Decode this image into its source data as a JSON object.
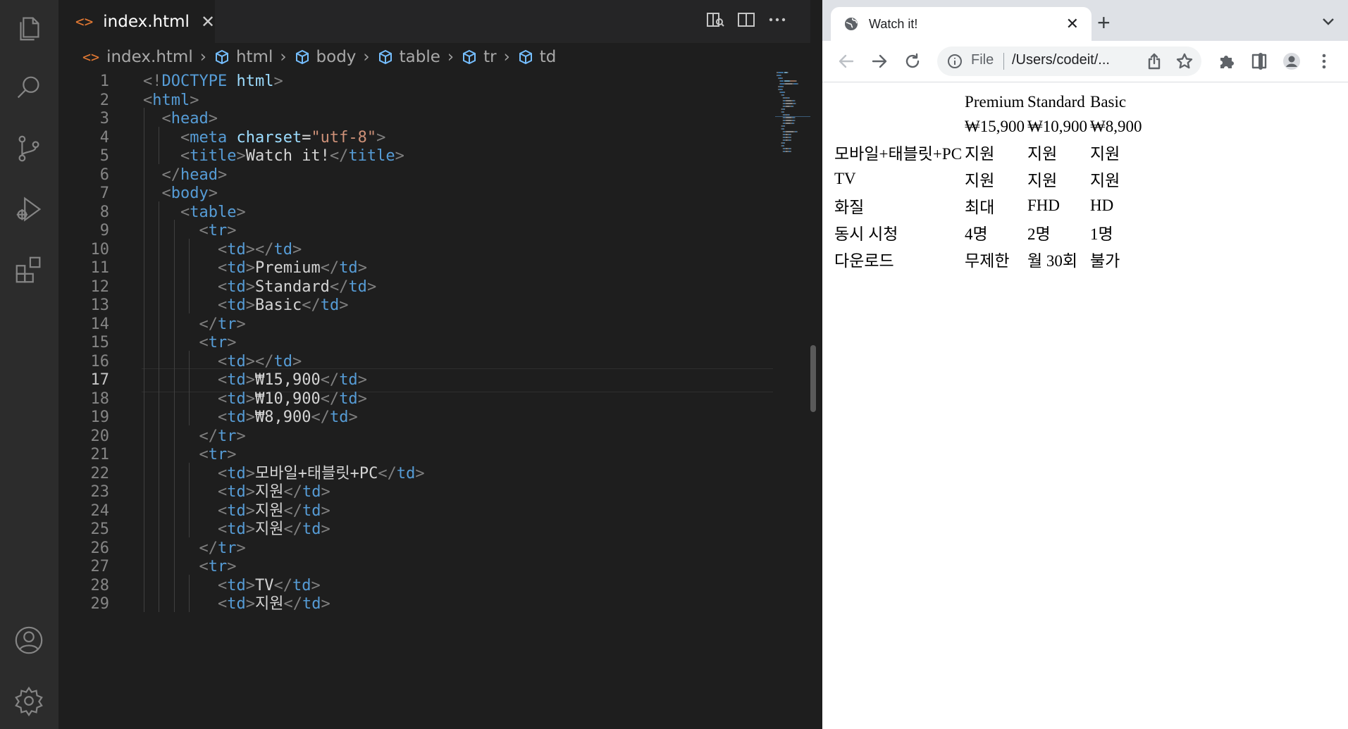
{
  "editor": {
    "tab_title": "index.html",
    "tab_icon": "<>",
    "breadcrumb": [
      "index.html",
      "html",
      "body",
      "table",
      "tr",
      "td"
    ],
    "current_line": 17,
    "lines": [
      [
        [
          "p",
          "<!"
        ],
        [
          "tag",
          "DOCTYPE"
        ],
        [
          "txt",
          " "
        ],
        [
          "attr",
          "html"
        ],
        [
          "p",
          ">"
        ]
      ],
      [
        [
          "p",
          "<"
        ],
        [
          "tag",
          "html"
        ],
        [
          "p",
          ">"
        ]
      ],
      [
        [
          "txt",
          "  "
        ],
        [
          "p",
          "<"
        ],
        [
          "tag",
          "head"
        ],
        [
          "p",
          ">"
        ]
      ],
      [
        [
          "txt",
          "    "
        ],
        [
          "p",
          "<"
        ],
        [
          "tag",
          "meta"
        ],
        [
          "txt",
          " "
        ],
        [
          "attr",
          "charset"
        ],
        [
          "txt",
          "="
        ],
        [
          "str",
          "\"utf-8\""
        ],
        [
          "p",
          ">"
        ]
      ],
      [
        [
          "txt",
          "    "
        ],
        [
          "p",
          "<"
        ],
        [
          "tag",
          "title"
        ],
        [
          "p",
          ">"
        ],
        [
          "txt",
          "Watch it!"
        ],
        [
          "p",
          "</"
        ],
        [
          "tag",
          "title"
        ],
        [
          "p",
          ">"
        ]
      ],
      [
        [
          "txt",
          "  "
        ],
        [
          "p",
          "</"
        ],
        [
          "tag",
          "head"
        ],
        [
          "p",
          ">"
        ]
      ],
      [
        [
          "txt",
          "  "
        ],
        [
          "p",
          "<"
        ],
        [
          "tag",
          "body"
        ],
        [
          "p",
          ">"
        ]
      ],
      [
        [
          "txt",
          "    "
        ],
        [
          "p",
          "<"
        ],
        [
          "tag",
          "table"
        ],
        [
          "p",
          ">"
        ]
      ],
      [
        [
          "txt",
          "      "
        ],
        [
          "p",
          "<"
        ],
        [
          "tag",
          "tr"
        ],
        [
          "p",
          ">"
        ]
      ],
      [
        [
          "txt",
          "        "
        ],
        [
          "p",
          "<"
        ],
        [
          "tag",
          "td"
        ],
        [
          "p",
          "></"
        ],
        [
          "tag",
          "td"
        ],
        [
          "p",
          ">"
        ]
      ],
      [
        [
          "txt",
          "        "
        ],
        [
          "p",
          "<"
        ],
        [
          "tag",
          "td"
        ],
        [
          "p",
          ">"
        ],
        [
          "txt",
          "Premium"
        ],
        [
          "p",
          "</"
        ],
        [
          "tag",
          "td"
        ],
        [
          "p",
          ">"
        ]
      ],
      [
        [
          "txt",
          "        "
        ],
        [
          "p",
          "<"
        ],
        [
          "tag",
          "td"
        ],
        [
          "p",
          ">"
        ],
        [
          "txt",
          "Standard"
        ],
        [
          "p",
          "</"
        ],
        [
          "tag",
          "td"
        ],
        [
          "p",
          ">"
        ]
      ],
      [
        [
          "txt",
          "        "
        ],
        [
          "p",
          "<"
        ],
        [
          "tag",
          "td"
        ],
        [
          "p",
          ">"
        ],
        [
          "txt",
          "Basic"
        ],
        [
          "p",
          "</"
        ],
        [
          "tag",
          "td"
        ],
        [
          "p",
          ">"
        ]
      ],
      [
        [
          "txt",
          "      "
        ],
        [
          "p",
          "</"
        ],
        [
          "tag",
          "tr"
        ],
        [
          "p",
          ">"
        ]
      ],
      [
        [
          "txt",
          "      "
        ],
        [
          "p",
          "<"
        ],
        [
          "tag",
          "tr"
        ],
        [
          "p",
          ">"
        ]
      ],
      [
        [
          "txt",
          "        "
        ],
        [
          "p",
          "<"
        ],
        [
          "tag",
          "td"
        ],
        [
          "p",
          "></"
        ],
        [
          "tag",
          "td"
        ],
        [
          "p",
          ">"
        ]
      ],
      [
        [
          "txt",
          "        "
        ],
        [
          "p",
          "<"
        ],
        [
          "tag",
          "td"
        ],
        [
          "p",
          ">"
        ],
        [
          "txt",
          "₩15,900"
        ],
        [
          "p",
          "</"
        ],
        [
          "tag",
          "td"
        ],
        [
          "p",
          ">"
        ]
      ],
      [
        [
          "txt",
          "        "
        ],
        [
          "p",
          "<"
        ],
        [
          "tag",
          "td"
        ],
        [
          "p",
          ">"
        ],
        [
          "txt",
          "₩10,900"
        ],
        [
          "p",
          "</"
        ],
        [
          "tag",
          "td"
        ],
        [
          "p",
          ">"
        ]
      ],
      [
        [
          "txt",
          "        "
        ],
        [
          "p",
          "<"
        ],
        [
          "tag",
          "td"
        ],
        [
          "p",
          ">"
        ],
        [
          "txt",
          "₩8,900"
        ],
        [
          "p",
          "</"
        ],
        [
          "tag",
          "td"
        ],
        [
          "p",
          ">"
        ]
      ],
      [
        [
          "txt",
          "      "
        ],
        [
          "p",
          "</"
        ],
        [
          "tag",
          "tr"
        ],
        [
          "p",
          ">"
        ]
      ],
      [
        [
          "txt",
          "      "
        ],
        [
          "p",
          "<"
        ],
        [
          "tag",
          "tr"
        ],
        [
          "p",
          ">"
        ]
      ],
      [
        [
          "txt",
          "        "
        ],
        [
          "p",
          "<"
        ],
        [
          "tag",
          "td"
        ],
        [
          "p",
          ">"
        ],
        [
          "txt",
          "모바일+태블릿+PC"
        ],
        [
          "p",
          "</"
        ],
        [
          "tag",
          "td"
        ],
        [
          "p",
          ">"
        ]
      ],
      [
        [
          "txt",
          "        "
        ],
        [
          "p",
          "<"
        ],
        [
          "tag",
          "td"
        ],
        [
          "p",
          ">"
        ],
        [
          "txt",
          "지원"
        ],
        [
          "p",
          "</"
        ],
        [
          "tag",
          "td"
        ],
        [
          "p",
          ">"
        ]
      ],
      [
        [
          "txt",
          "        "
        ],
        [
          "p",
          "<"
        ],
        [
          "tag",
          "td"
        ],
        [
          "p",
          ">"
        ],
        [
          "txt",
          "지원"
        ],
        [
          "p",
          "</"
        ],
        [
          "tag",
          "td"
        ],
        [
          "p",
          ">"
        ]
      ],
      [
        [
          "txt",
          "        "
        ],
        [
          "p",
          "<"
        ],
        [
          "tag",
          "td"
        ],
        [
          "p",
          ">"
        ],
        [
          "txt",
          "지원"
        ],
        [
          "p",
          "</"
        ],
        [
          "tag",
          "td"
        ],
        [
          "p",
          ">"
        ]
      ],
      [
        [
          "txt",
          "      "
        ],
        [
          "p",
          "</"
        ],
        [
          "tag",
          "tr"
        ],
        [
          "p",
          ">"
        ]
      ],
      [
        [
          "txt",
          "      "
        ],
        [
          "p",
          "<"
        ],
        [
          "tag",
          "tr"
        ],
        [
          "p",
          ">"
        ]
      ],
      [
        [
          "txt",
          "        "
        ],
        [
          "p",
          "<"
        ],
        [
          "tag",
          "td"
        ],
        [
          "p",
          ">"
        ],
        [
          "txt",
          "TV"
        ],
        [
          "p",
          "</"
        ],
        [
          "tag",
          "td"
        ],
        [
          "p",
          ">"
        ]
      ],
      [
        [
          "txt",
          "        "
        ],
        [
          "p",
          "<"
        ],
        [
          "tag",
          "td"
        ],
        [
          "p",
          ">"
        ],
        [
          "txt",
          "지원"
        ],
        [
          "p",
          "</"
        ],
        [
          "tag",
          "td"
        ],
        [
          "p",
          ">"
        ]
      ]
    ]
  },
  "browser": {
    "tab_title": "Watch it!",
    "tab_close": "✕",
    "new_tab": "+",
    "address_scheme": "File",
    "address_url": "/Users/codeit/...",
    "table": [
      [
        "",
        "Premium",
        "Standard",
        "Basic"
      ],
      [
        "",
        "₩15,900",
        "₩10,900",
        "₩8,900"
      ],
      [
        "모바일+태블릿+PC",
        "지원",
        "지원",
        "지원"
      ],
      [
        "TV",
        "지원",
        "지원",
        "지원"
      ],
      [
        "화질",
        "최대",
        "FHD",
        "HD"
      ],
      [
        "동시 시청",
        "4명",
        "2명",
        "1명"
      ],
      [
        "다운로드",
        "무제한",
        "월 30회",
        "불가"
      ]
    ]
  },
  "colors": {
    "syntax_tag": "#569cd6",
    "syntax_attr": "#9cdcfe",
    "syntax_string": "#ce9178",
    "syntax_punct": "#808080",
    "html_icon": "#e37933"
  }
}
